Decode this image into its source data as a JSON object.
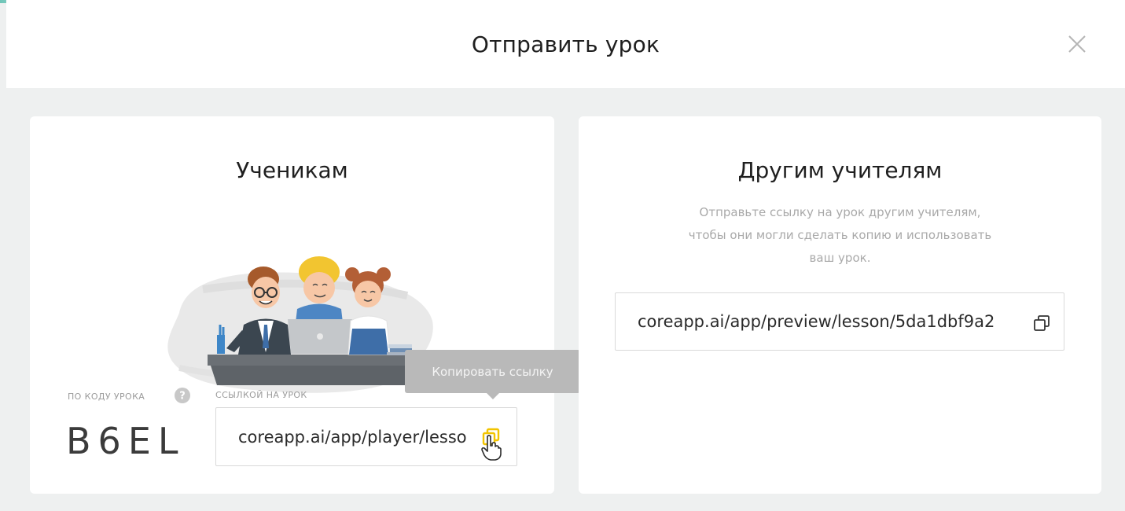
{
  "dialog": {
    "title": "Отправить урок",
    "close_icon": "close-icon"
  },
  "students": {
    "title": "Ученикам",
    "code_label": "ПО КОДУ УРОКА",
    "help_icon": "help-icon",
    "code": "B6EL",
    "link_label": "ССЫЛКОЙ НА УРОК",
    "link": "coreapp.ai/app/player/lesson",
    "copy_icon": "copy-icon",
    "tooltip": "Копировать ссылку"
  },
  "teachers": {
    "title": "Другим учителям",
    "description": "Отправьте ссылку на урок другим учителям, чтобы они могли сделать копию и использовать ваш урок.",
    "link": "coreapp.ai/app/preview/lesson/5da1dbf9a2",
    "copy_icon": "copy-icon"
  },
  "colors": {
    "background": "#eef0f0",
    "card": "#ffffff",
    "copy_highlight": "#f2c400",
    "tooltip": "#b9b9b9",
    "muted_text": "#a9a9a9"
  }
}
